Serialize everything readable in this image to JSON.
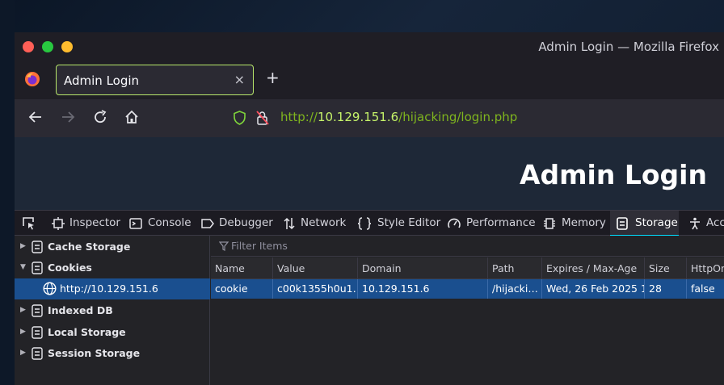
{
  "window": {
    "title": "Admin Login — Mozilla Firefox"
  },
  "tabs": [
    {
      "label": "Admin Login",
      "close": "×"
    }
  ],
  "new_tab": "+",
  "nav": {
    "url_scheme": "http://",
    "url_host": "10.129.151.6",
    "url_path": "/hijacking/login.php"
  },
  "page": {
    "heading": "Admin Login"
  },
  "devtools": {
    "tabs": [
      {
        "label": "Inspector",
        "icon": "inspector-icon"
      },
      {
        "label": "Console",
        "icon": "console-icon"
      },
      {
        "label": "Debugger",
        "icon": "debugger-icon"
      },
      {
        "label": "Network",
        "icon": "network-icon"
      },
      {
        "label": "Style Editor",
        "icon": "style-editor-icon"
      },
      {
        "label": "Performance",
        "icon": "performance-icon"
      },
      {
        "label": "Memory",
        "icon": "memory-icon"
      },
      {
        "label": "Storage",
        "icon": "storage-icon",
        "active": true
      },
      {
        "label": "Acc",
        "icon": "accessibility-icon"
      }
    ],
    "storage_tree": [
      {
        "label": "Cache Storage",
        "expanded": false
      },
      {
        "label": "Cookies",
        "expanded": true
      },
      {
        "label": "http://10.129.151.6",
        "child": true,
        "selected": true
      },
      {
        "label": "Indexed DB",
        "expanded": false
      },
      {
        "label": "Local Storage",
        "expanded": false
      },
      {
        "label": "Session Storage",
        "expanded": false
      }
    ],
    "filter_placeholder": "Filter Items",
    "columns": [
      "Name",
      "Value",
      "Domain",
      "Path",
      "Expires / Max-Age",
      "Size",
      "HttpOnl"
    ],
    "rows": [
      [
        "cookie",
        "c00k1355h0u1…",
        "10.129.151.6",
        "/hijacki…",
        "Wed, 26 Feb 2025 1…",
        "28",
        "false"
      ]
    ]
  },
  "colors": {
    "accent": "#00ddff",
    "selected_row": "#1a4f8f",
    "tab_border": "#b8e86b",
    "url_host": "#c6f36a"
  }
}
